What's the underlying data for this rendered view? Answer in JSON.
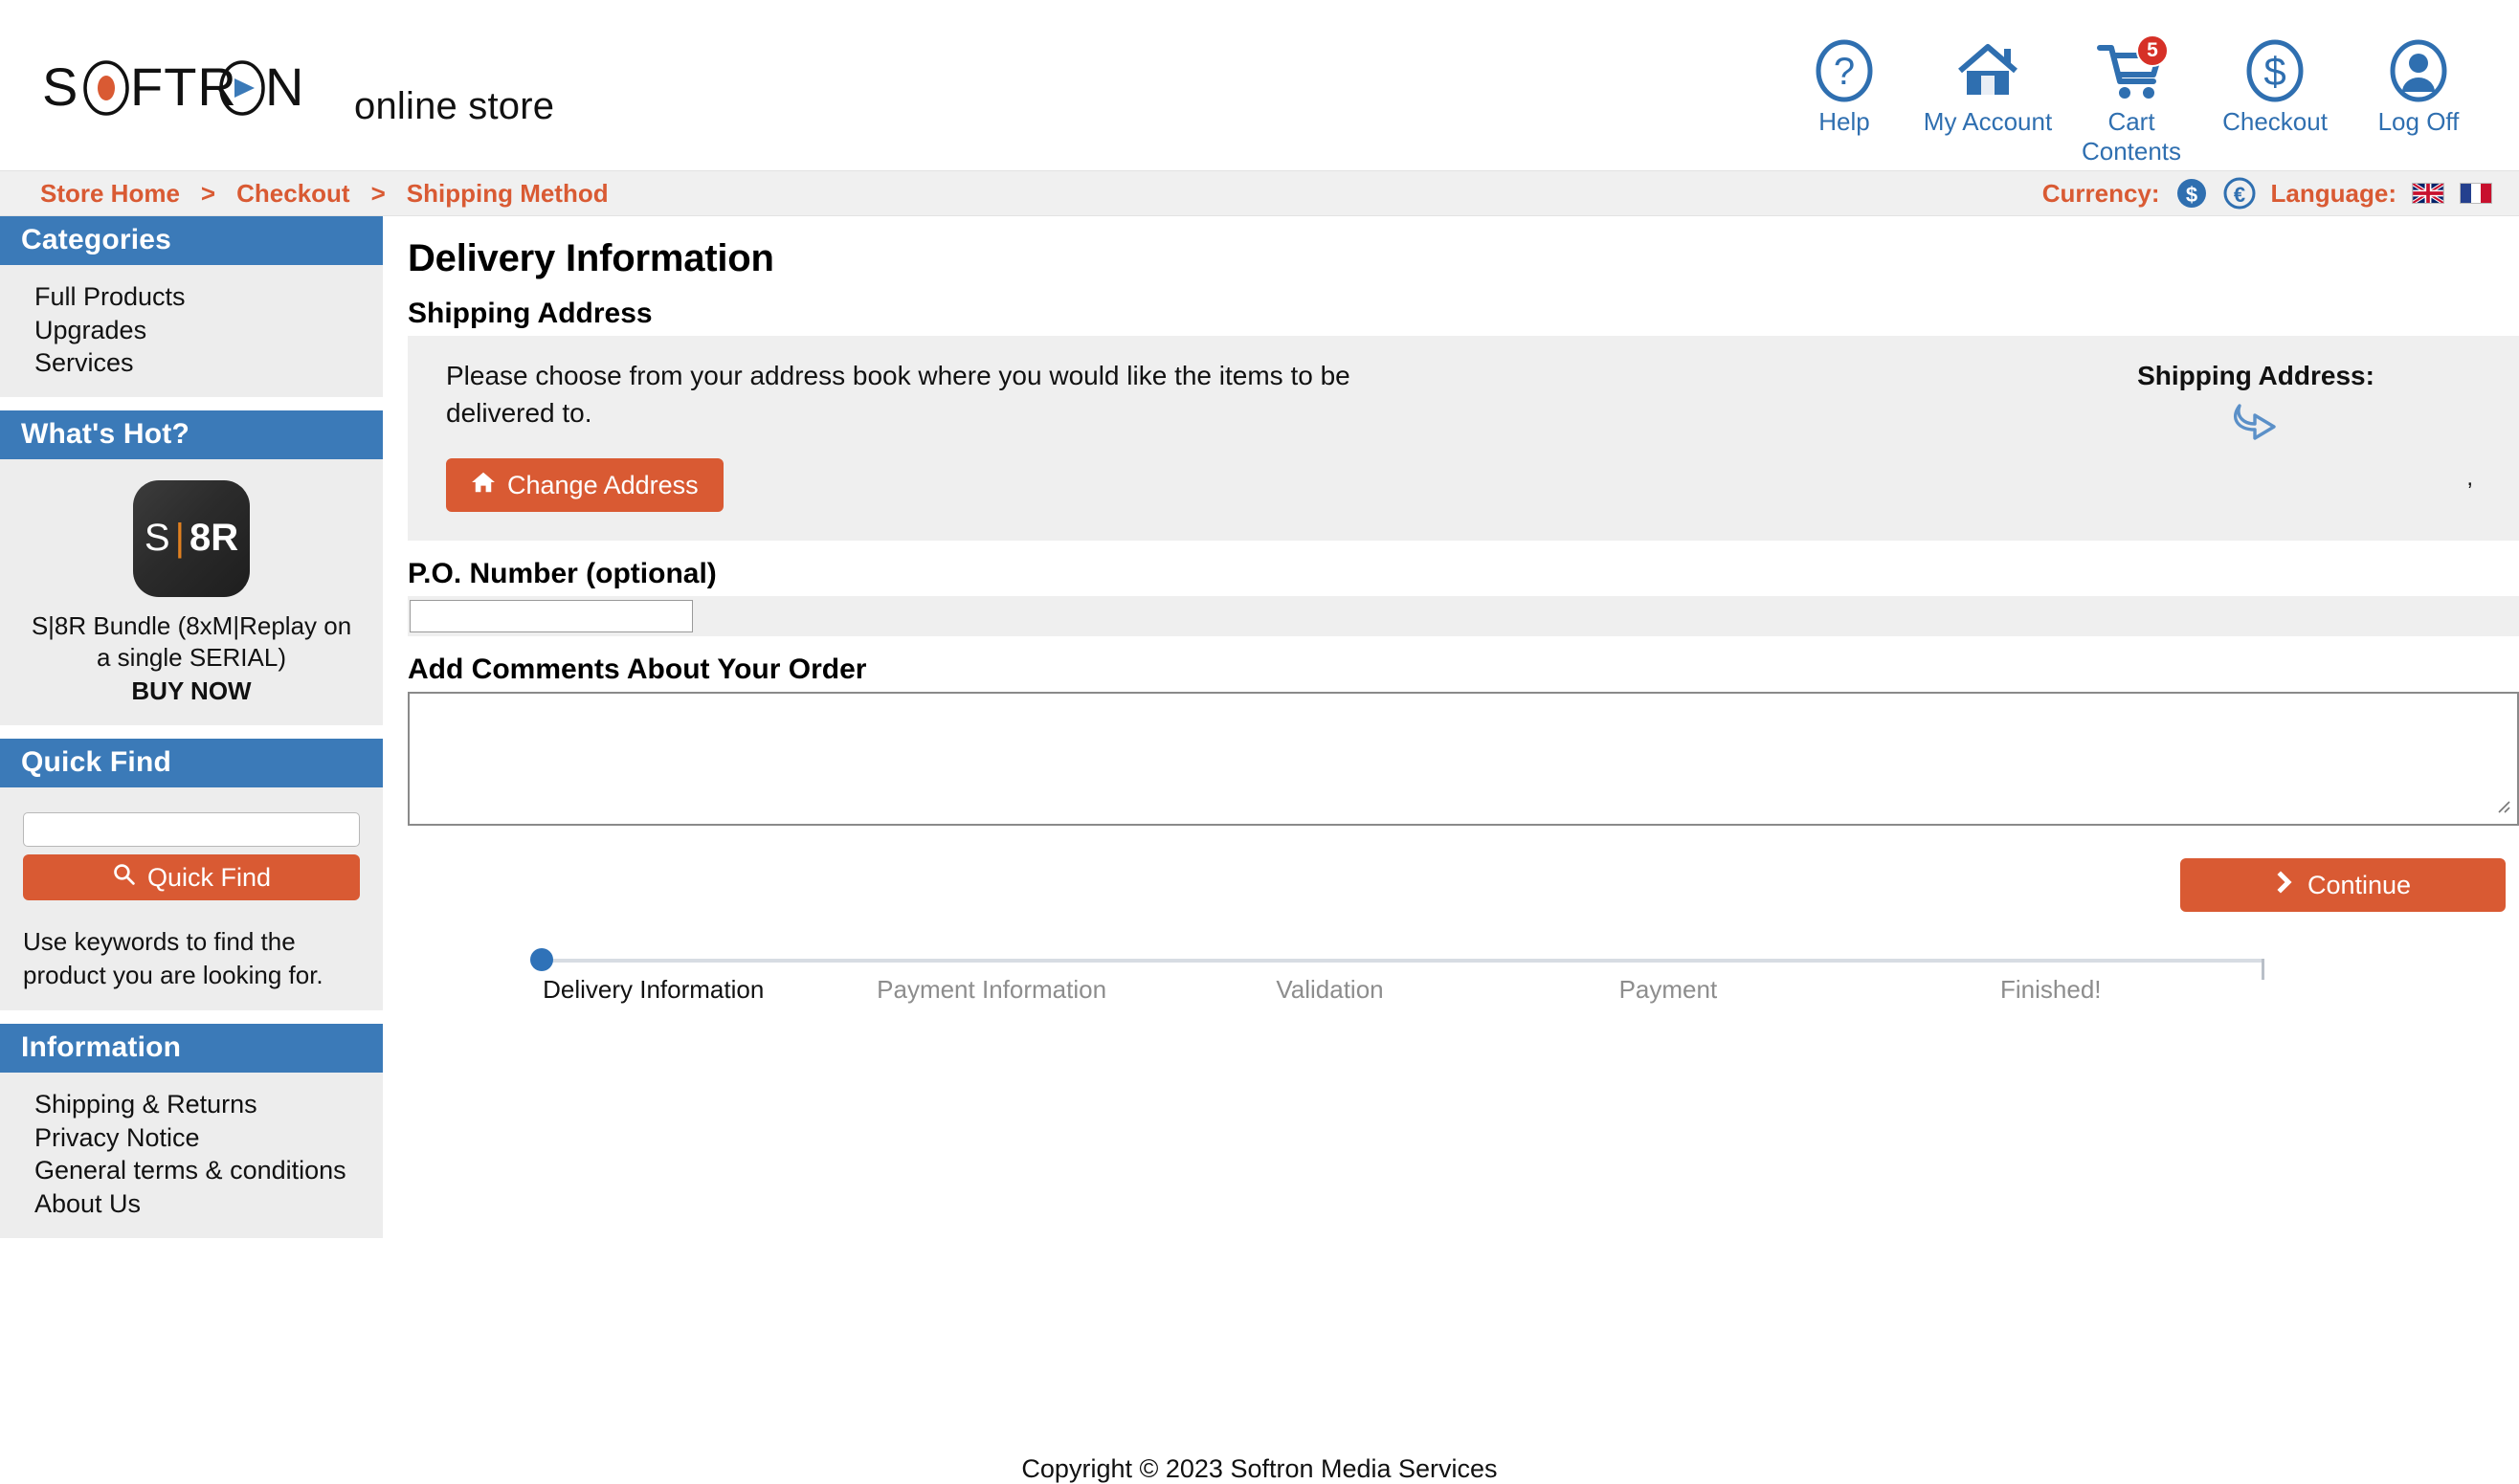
{
  "header": {
    "brand": "SOFTRON",
    "brand_sub": "online store",
    "nav": [
      {
        "label": "Help",
        "icon": "help-circle-icon"
      },
      {
        "label": "My Account",
        "icon": "house-icon"
      },
      {
        "label": "Cart Contents",
        "icon": "shopping-cart-icon",
        "badge": "5"
      },
      {
        "label": "Checkout",
        "icon": "dollar-circle-icon"
      },
      {
        "label": "Log Off",
        "icon": "user-circle-icon"
      }
    ]
  },
  "breadcrumb": {
    "items": [
      "Store Home",
      "Checkout",
      "Shipping Method"
    ],
    "separator": ">",
    "currency_label": "Currency:",
    "currency_options": [
      "$",
      "€"
    ],
    "language_label": "Language:",
    "language_options": [
      "uk-flag-icon",
      "france-flag-icon"
    ]
  },
  "sidebar": {
    "categories": {
      "title": "Categories",
      "items": [
        "Full Products",
        "Upgrades",
        "Services"
      ]
    },
    "whats_hot": {
      "title": "What's Hot?",
      "product_icon": {
        "s": "S",
        "bar": "|",
        "r": "8R"
      },
      "product_name": "S|8R Bundle (8xM|Replay on a single SERIAL)",
      "buy_now": "BUY NOW"
    },
    "quick_find": {
      "title": "Quick Find",
      "input_value": "",
      "input_placeholder": "",
      "button_label": "Quick Find",
      "help_text": "Use keywords to find the product you are looking for."
    },
    "information": {
      "title": "Information",
      "items": [
        "Shipping & Returns",
        "Privacy Notice",
        "General terms & conditions",
        "About Us"
      ]
    }
  },
  "main": {
    "page_title": "Delivery Information",
    "shipping_address_heading": "Shipping Address",
    "panel_text": "Please choose from your address book where you would like the items to be delivered to.",
    "change_address_label": "Change Address",
    "address_summary_title": "Shipping Address:",
    "address_summary_value": ",",
    "po_number_label": "P.O. Number (optional)",
    "po_number_value": "",
    "po_number_placeholder": "",
    "comments_label": "Add Comments About Your Order",
    "comments_value": "",
    "comments_placeholder": "",
    "continue_label": "Continue"
  },
  "stepper": {
    "steps": [
      "Delivery Information",
      "Payment Information",
      "Validation",
      "Payment",
      "Finished!"
    ],
    "active_index": 0
  },
  "footer": {
    "copyright": "Copyright © 2023 Softron Media Services"
  },
  "colors": {
    "accent_orange": "#d95a33",
    "panel_blue": "#3b7ab8",
    "link_blue": "#2f6fb0",
    "badge_red": "#d63027",
    "panel_gray": "#efefef"
  }
}
